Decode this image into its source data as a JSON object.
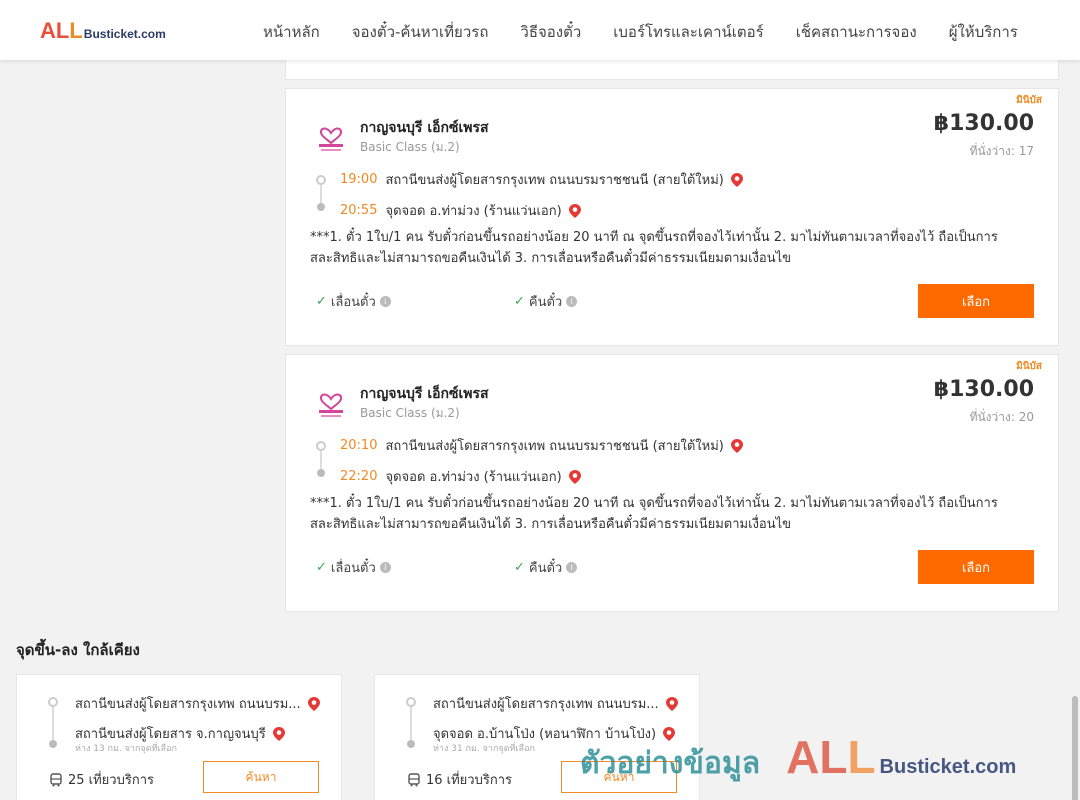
{
  "header": {
    "logo_all": "ALL",
    "logo_rest": "Busticket.com",
    "nav": [
      "หน้าหลัก",
      "จองตั๋ว-ค้นหาเที่ยวรถ",
      "วิธีจองตั๋ว",
      "เบอร์โทรและเคาน์เตอร์",
      "เช็คสถานะการจอง",
      "ผู้ให้บริการ"
    ]
  },
  "trips": [
    {
      "tag": "มินิบัส",
      "operator": "กาญจนบุรี เอ็กซ์เพรส",
      "class": "Basic Class (ม.2)",
      "price": "฿130.00",
      "seats": "ที่นั่งว่าง: 17",
      "depart_time": "19:00",
      "depart_place": "สถานีขนส่งผู้โดยสารกรุงเทพ ถนนบรมราชชนนี (สายใต้ใหม่)",
      "arrive_time": "20:55",
      "arrive_place": "จุดจอด อ.ท่าม่วง (ร้านแว่นเอก)",
      "note": "***1. ตั๋ว 1ใบ/1 คน รับตั๋วก่อนขึ้นรถอย่างน้อย 20 นาที ณ จุดขึ้นรถที่จองไว้เท่านั้น 2. มาไม่ทันตามเวลาที่จองไว้ ถือเป็นการสละสิทธิและไม่สามารถขอคืนเงินได้ 3. การเลื่อนหรือคืนตั๋วมีค่าธรรมเนียมตามเงื่อนไข",
      "opt_change": "เลื่อนตั๋ว",
      "opt_refund": "คืนตั๋ว",
      "select_label": "เลือก"
    },
    {
      "tag": "มินิบัส",
      "operator": "กาญจนบุรี เอ็กซ์เพรส",
      "class": "Basic Class (ม.2)",
      "price": "฿130.00",
      "seats": "ที่นั่งว่าง: 20",
      "depart_time": "20:10",
      "depart_place": "สถานีขนส่งผู้โดยสารกรุงเทพ ถนนบรมราชชนนี (สายใต้ใหม่)",
      "arrive_time": "22:20",
      "arrive_place": "จุดจอด อ.ท่าม่วง (ร้านแว่นเอก)",
      "note": "***1. ตั๋ว 1ใบ/1 คน รับตั๋วก่อนขึ้นรถอย่างน้อย 20 นาที ณ จุดขึ้นรถที่จองไว้เท่านั้น 2. มาไม่ทันตามเวลาที่จองไว้ ถือเป็นการสละสิทธิและไม่สามารถขอคืนเงินได้ 3. การเลื่อนหรือคืนตั๋วมีค่าธรรมเนียมตามเงื่อนไข",
      "opt_change": "เลื่อนตั๋ว",
      "opt_refund": "คืนตั๋ว",
      "select_label": "เลือก"
    }
  ],
  "nearby": {
    "title": "จุดขึ้น-ลง ใกล้เคียง",
    "cards": [
      {
        "from": "สถานีขนส่งผู้โดยสารกรุงเทพ ถนนบรม...",
        "to": "สถานีขนส่งผู้โดยสาร จ.กาญจนบุรี",
        "distance": "ห่าง 13 กม. จากจุดที่เลือก",
        "trips": "25 เที่ยวบริการ",
        "button": "ค้นหา"
      },
      {
        "from": "สถานีขนส่งผู้โดยสารกรุงเทพ ถนนบรม...",
        "to": "จุดจอด อ.บ้านโป่ง (หอนาฬิกา บ้านโป่ง)",
        "distance": "ห่าง 31 กม. จากจุดที่เลือก",
        "trips": "16 เที่ยวบริการ",
        "button": "ค้นหา"
      }
    ]
  },
  "watermark": {
    "thai": "ตัวอย่างข้อมูล",
    "all": "ALL",
    "rest": "Busticket.com"
  },
  "colors": {
    "accent": "#ff6a00",
    "time": "#f08a24",
    "check": "#3aa655",
    "pin": "#e53935"
  }
}
